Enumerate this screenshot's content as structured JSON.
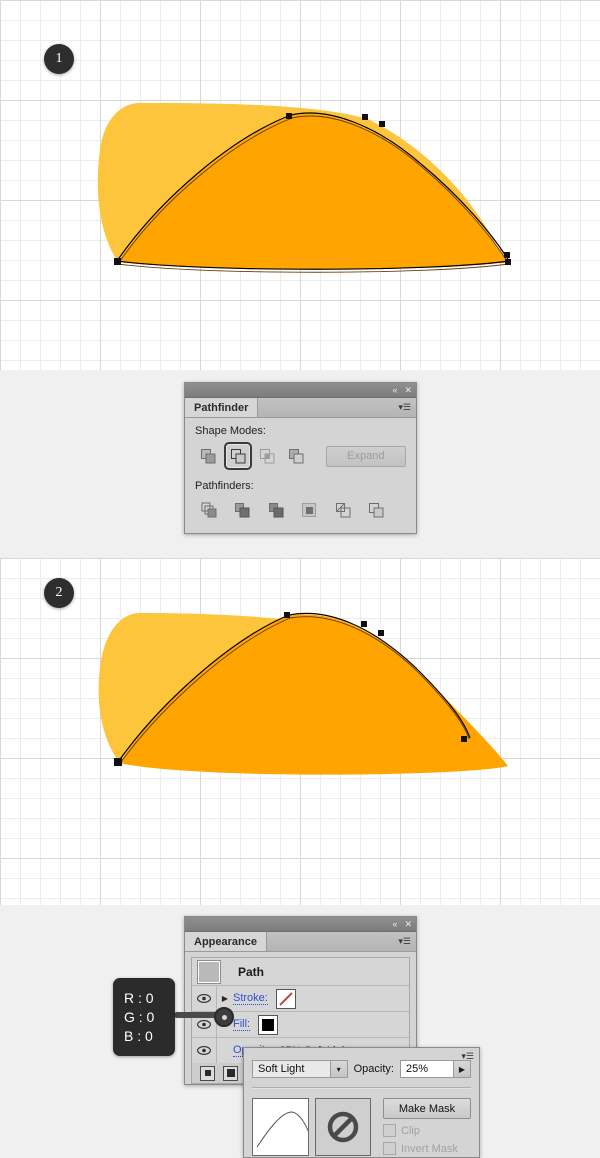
{
  "canvas": {
    "step1_badge": "1",
    "step2_badge": "2",
    "shape_light_color": "#FCC53C",
    "shape_dark_color": "#FFA400",
    "path_stroke_color": "#000000",
    "grid_minor_color": "#ECECEC",
    "grid_major_color": "#D8D8D8"
  },
  "pathfinder_panel": {
    "titlebar": {
      "collapse_icon": "«",
      "close_icon": "✕"
    },
    "tab_label": "Pathfinder",
    "menu_icon": "▾☰",
    "shape_modes_label": "Shape Modes:",
    "shape_modes": [
      {
        "name": "unite",
        "selected": false
      },
      {
        "name": "minus-front",
        "selected": true
      },
      {
        "name": "intersect",
        "selected": false
      },
      {
        "name": "exclude",
        "selected": false
      }
    ],
    "expand_label": "Expand",
    "expand_enabled": false,
    "pathfinders_label": "Pathfinders:",
    "pathfinders": [
      {
        "name": "divide"
      },
      {
        "name": "trim"
      },
      {
        "name": "merge"
      },
      {
        "name": "crop"
      },
      {
        "name": "outline"
      },
      {
        "name": "minus-back"
      }
    ]
  },
  "appearance_panel": {
    "titlebar": {
      "collapse_icon": "«",
      "close_icon": "✕"
    },
    "tab_label": "Appearance",
    "menu_icon": "▾☰",
    "object_title": "Path",
    "rows": [
      {
        "label": "Stroke:",
        "value": "",
        "swatch": "none-diagonal",
        "has_triangle": true,
        "visible": true
      },
      {
        "label": "Fill:",
        "value": "",
        "swatch": "black",
        "has_triangle": false,
        "visible": true
      },
      {
        "label": "Opacity:",
        "value": "25% Soft Light",
        "swatch": "",
        "has_triangle": false,
        "visible": true
      }
    ],
    "footer_buttons": [
      "new-art-maintains-appearance",
      "clear-appearance"
    ]
  },
  "rgb_tooltip": {
    "lines": [
      "R : 0",
      "G : 0",
      "B : 0"
    ],
    "r": "0",
    "g": "0",
    "b": "0",
    "background": "#2B2B2B"
  },
  "transparency_panel": {
    "menu_icon": "▾☰",
    "blend_mode": "Soft Light",
    "blend_dropdown_arrow": "▾",
    "opacity_label": "Opacity:",
    "opacity_value": "25%",
    "opacity_arrow": "▶",
    "make_mask_label": "Make Mask",
    "clip_label": "Clip",
    "clip_checked": false,
    "clip_enabled": false,
    "invert_mask_label": "Invert Mask",
    "invert_mask_checked": false,
    "invert_mask_enabled": false,
    "mask_thumb_state": "no-mask"
  }
}
